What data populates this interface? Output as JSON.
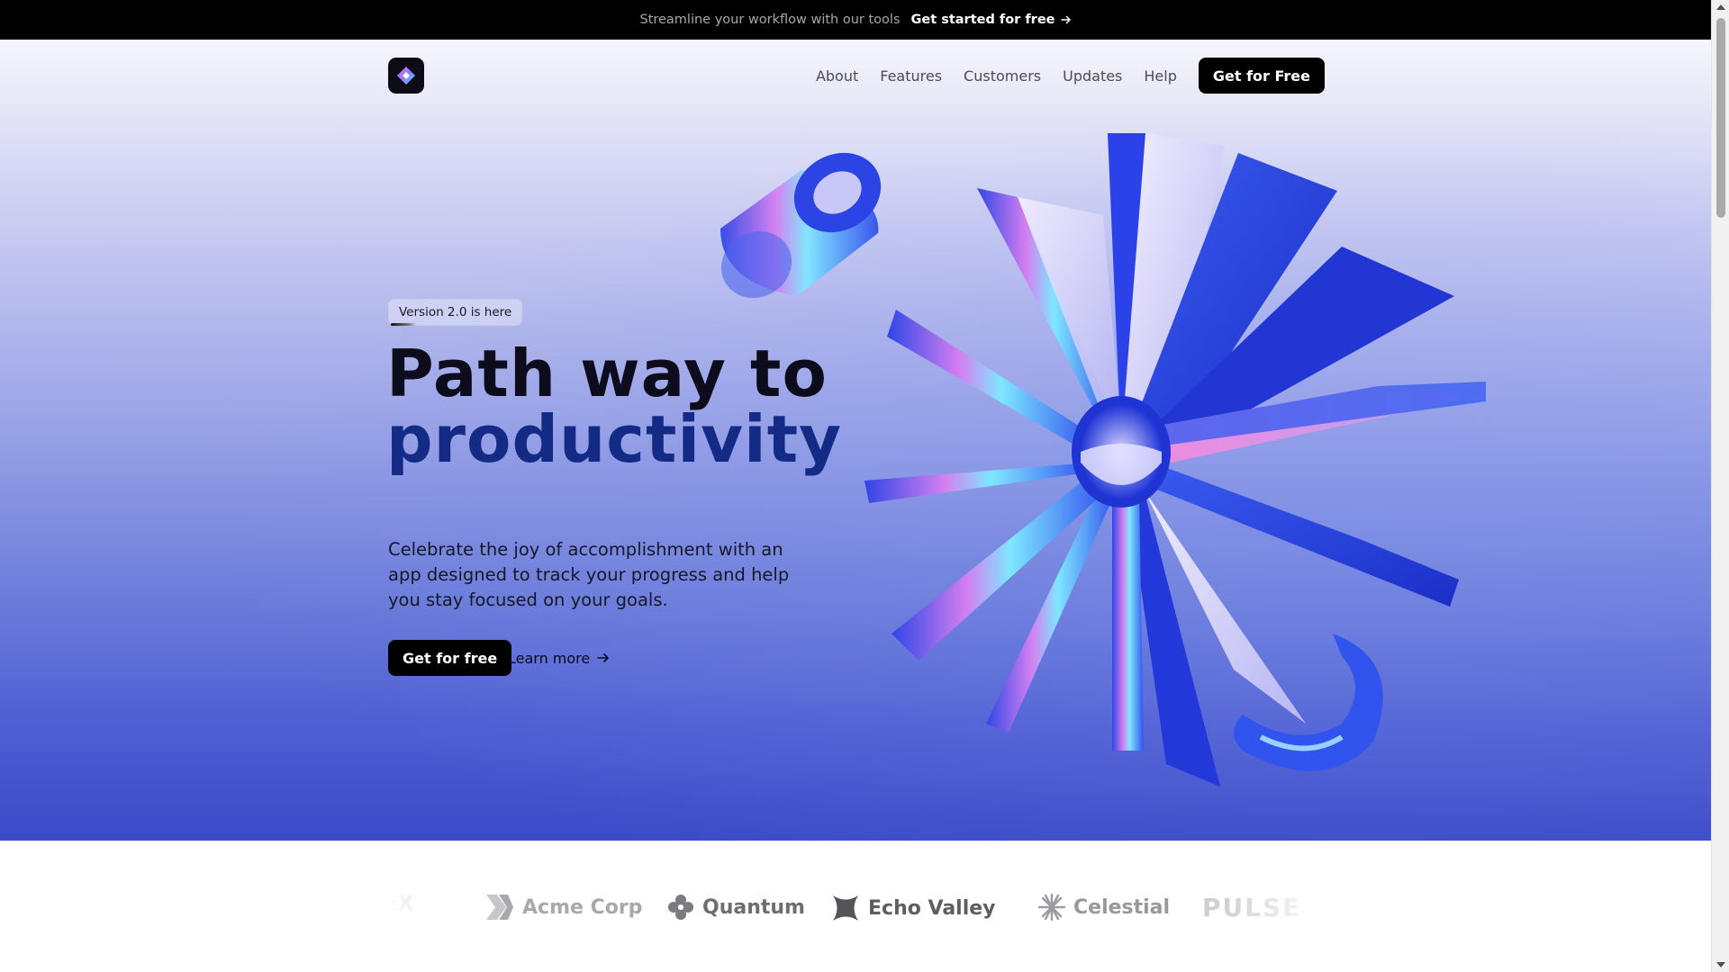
{
  "announcement": {
    "text": "Streamline your workflow with our tools",
    "link_label": "Get started for free",
    "icon": "arrow-right-icon"
  },
  "nav": {
    "logo_icon": "diamond-logo-icon",
    "links": [
      "About",
      "Features",
      "Customers",
      "Updates",
      "Help"
    ],
    "cta_label": "Get for Free"
  },
  "hero": {
    "badge": "Version 2.0 is here",
    "headline_line1": "Path way to",
    "headline_line2": "productivity",
    "subtitle": "Celebrate the joy of accomplishment with an app designed to track your progress and help you stay focused on your goals.",
    "primary_cta": "Get for free",
    "secondary_cta": "Learn more",
    "secondary_icon": "arrow-right-icon"
  },
  "logos": {
    "items": [
      {
        "name": "APEX",
        "shown": "PEX",
        "icon": "apex-logo-icon"
      },
      {
        "name": "Acme Corp",
        "icon": "acme-chevrons-icon"
      },
      {
        "name": "Quantum",
        "icon": "quantum-clover-icon"
      },
      {
        "name": "Echo Valley",
        "icon": "echo-valley-x-icon"
      },
      {
        "name": "Celestial",
        "icon": "celestial-asterisk-icon"
      },
      {
        "name": "PULSE",
        "shown": "PULSE",
        "icon": "pulse-wordmark-icon"
      }
    ]
  },
  "colors": {
    "announcement_bg": "#000000",
    "hero_top": "#f6f6fc",
    "hero_bottom": "#3b4ac8",
    "headline_line2": "#142b86",
    "button_bg": "#000000"
  }
}
